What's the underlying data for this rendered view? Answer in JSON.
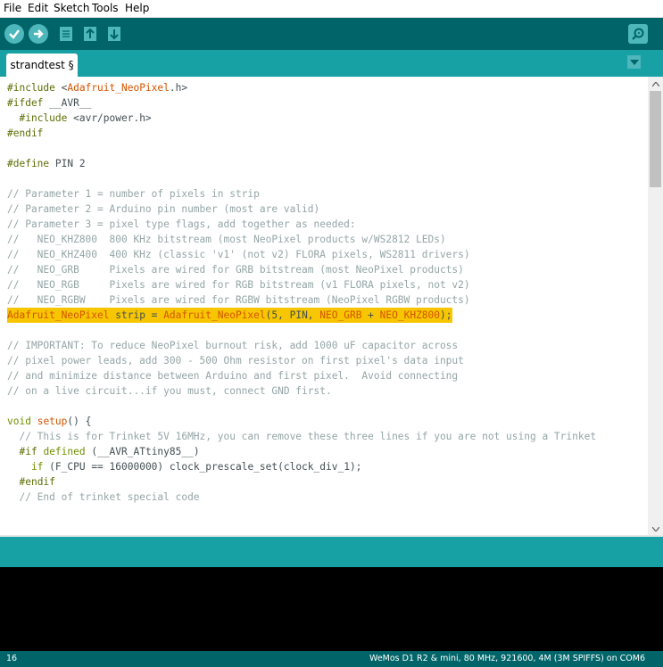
{
  "menu": [
    "File",
    "Edit",
    "Sketch",
    "Tools",
    "Help"
  ],
  "toolbar": {
    "buttons": [
      "verify",
      "upload",
      "new",
      "open",
      "save"
    ],
    "serial_monitor": "serial-monitor"
  },
  "tab": {
    "label": "strandtest §"
  },
  "code": [
    "#include <Adafruit_NeoPixel.h>",
    "#ifdef __AVR__",
    "  #include <avr/power.h>",
    "#endif",
    "",
    "#define PIN 2",
    "",
    "// Parameter 1 = number of pixels in strip",
    "// Parameter 2 = Arduino pin number (most are valid)",
    "// Parameter 3 = pixel type flags, add together as needed:",
    "//   NEO_KHZ800  800 KHz bitstream (most NeoPixel products w/WS2812 LEDs)",
    "//   NEO_KHZ400  400 KHz (classic 'v1' (not v2) FLORA pixels, WS2811 drivers)",
    "//   NEO_GRB     Pixels are wired for GRB bitstream (most NeoPixel products)",
    "//   NEO_RGB     Pixels are wired for RGB bitstream (v1 FLORA pixels, not v2)",
    "//   NEO_RGBW    Pixels are wired for RGBW bitstream (NeoPixel RGBW products)",
    "Adafruit_NeoPixel strip = Adafruit_NeoPixel(5, PIN, NEO_GRB + NEO_KHZ800);",
    "",
    "// IMPORTANT: To reduce NeoPixel burnout risk, add 1000 uF capacitor across",
    "// pixel power leads, add 300 - 500 Ohm resistor on first pixel's data input",
    "// and minimize distance between Arduino and first pixel.  Avoid connecting",
    "// on a live circuit...if you must, connect GND first.",
    "",
    "void setup() {",
    "  // This is for Trinket 5V 16MHz, you can remove these three lines if you are not using a Trinket",
    "  #if defined (__AVR_ATtiny85__)",
    "    if (F_CPU == 16000000) clock_prescale_set(clock_div_1);",
    "  #endif",
    "  // End of trinket special code"
  ],
  "highlighted_line": 15,
  "footer": {
    "line_number": "16",
    "board": "WeMos D1 R2 & mini, 80 MHz, 921600, 4M (3M SPIFFS) on COM6"
  },
  "colors": {
    "toolbar": "#006468",
    "tabbar": "#17a1a5",
    "highlight": "#f7c600",
    "console": "#000000"
  }
}
